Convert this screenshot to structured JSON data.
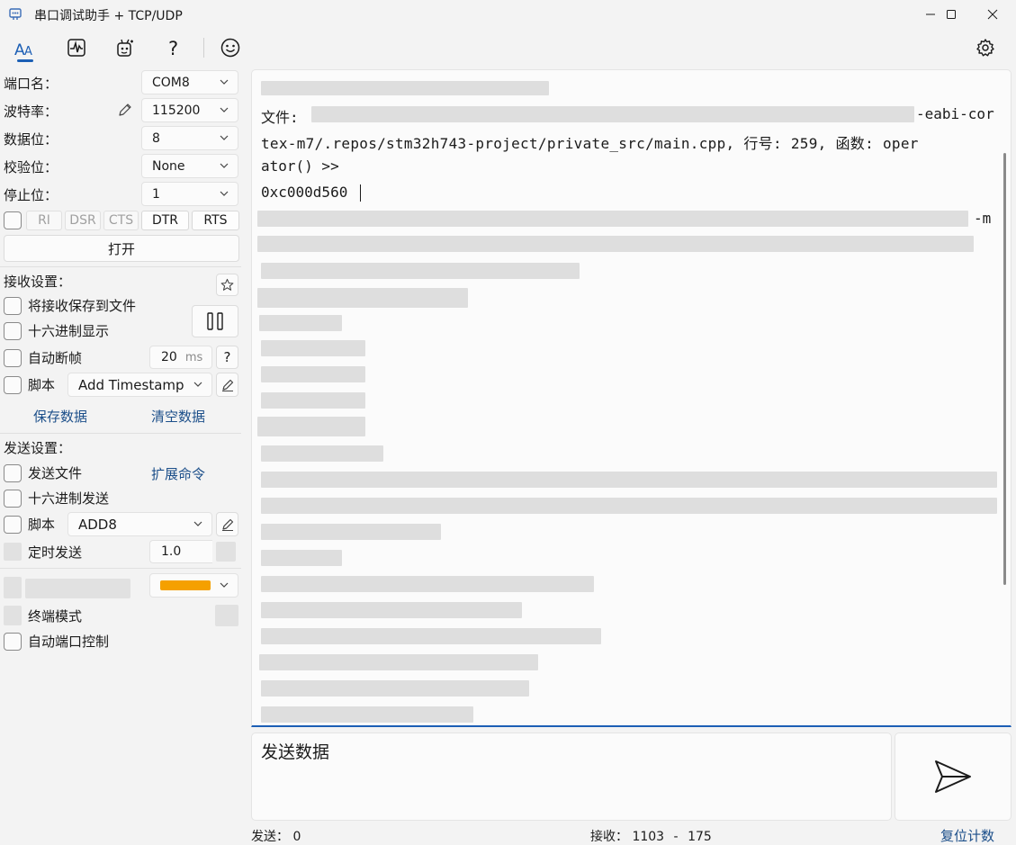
{
  "window": {
    "title": "串口调试助手 + TCP/UDP",
    "app_icon": "serial-port-icon",
    "controls": [
      "minimize-icon",
      "maximize-icon",
      "close-icon"
    ]
  },
  "toolbar": {
    "icons": [
      "font-icon",
      "waveform-icon",
      "plugin-icon",
      "help-icon",
      "smiley-icon",
      "gear-icon"
    ],
    "active": "font-icon"
  },
  "serial": {
    "port_label": "端口名：",
    "port_value": "COM8",
    "baud_label": "波特率：",
    "baud_value": "115200",
    "databits_label": "数据位：",
    "databits_value": "8",
    "parity_label": "校验位：",
    "parity_value": "None",
    "stopbits_label": "停止位：",
    "stopbits_value": "1",
    "signals": [
      "RI",
      "DSR",
      "CTS",
      "DTR",
      "RTS"
    ],
    "open_button": "打开"
  },
  "receive_settings": {
    "title": "接收设置：",
    "save_to_file": "将接收保存到文件",
    "hex_display": "十六进制显示",
    "auto_frame": "自动断帧",
    "auto_frame_value": "20",
    "auto_frame_unit": "ms",
    "help": "?",
    "script_label": "脚本",
    "script_value": "Add Timestamp",
    "save_data": "保存数据",
    "clear_data": "清空数据"
  },
  "send_settings": {
    "title": "发送设置：",
    "send_file": "发送文件",
    "extend_cmd": "扩展命令",
    "hex_send": "十六进制发送",
    "script_label": "脚本",
    "script_value": "ADD8",
    "timed_send": "定时发送",
    "timed_value": "1.0",
    "terminal_mode": "终端模式",
    "auto_port": "自动端口控制",
    "highlight_color": "#f5a000"
  },
  "receive_area": {
    "line_file_label": "文件:",
    "line_file_suffix": "-eabi-cor",
    "line_path": "tex-m7/.repos/stm32h743-project/private_src/main.cpp, 行号: 259, 函数: oper",
    "line_func": "ator() >>",
    "line_addr": "0xc000d560",
    "line_tail": "-m"
  },
  "send_area": {
    "placeholder": "发送数据",
    "send_icon": "send-icon"
  },
  "status_bar": {
    "sent_label": "发送：",
    "sent_value": "0",
    "recv_label": "接收：",
    "recv_value": "1103",
    "recv_sep": "-",
    "recv_value2": "175",
    "reset_counts": "复位计数"
  },
  "colors": {
    "accent": "#1c5fb5",
    "link": "#1c4f8a",
    "background": "#f3f3f3"
  }
}
